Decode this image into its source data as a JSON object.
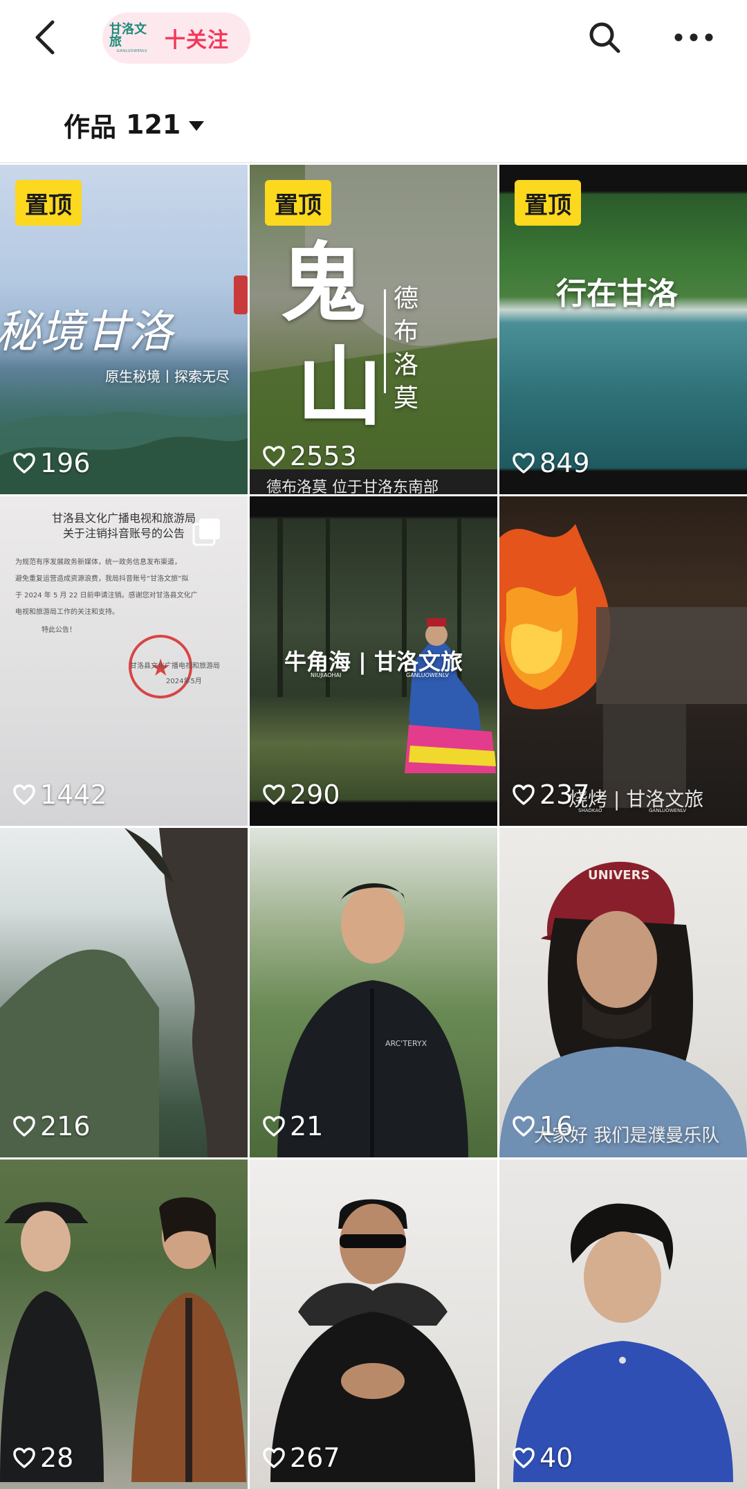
{
  "header": {
    "follow_button": "十关注",
    "brand_logo_text": "甘洛文旅",
    "brand_logo_subtext": "GANLUOWENLV"
  },
  "works": {
    "label": "作品",
    "count": "121"
  },
  "grid": {
    "pin_label": "置顶",
    "tiles": [
      {
        "likes": "196",
        "pinned": true,
        "title": "秘境甘洛",
        "subtitle": "原生秘境丨探索无尽"
      },
      {
        "likes": "2553",
        "pinned": true,
        "title_big_1": "鬼",
        "title_big_2": "山",
        "vertical_title": "德布洛莫",
        "caption": "德布洛莫 位于甘洛东南部"
      },
      {
        "likes": "849",
        "pinned": true,
        "title": "行在甘洛"
      },
      {
        "likes": "1442",
        "pinned": false,
        "doc_title_1": "甘洛县文化广播电视和旅游局",
        "doc_title_2": "关于注销抖音账号的公告",
        "doc_body_1": "为规范有序发展政务新媒体，统一政务信息发布渠道，",
        "doc_body_2": "避免重复运营造成资源浪费，我局抖音账号“甘洛文旅”拟",
        "doc_body_3": "于 2024 年 5 月 22 日前申请注销。感谢您对甘洛县文化广",
        "doc_body_4": "电视和旅游局工作的关注和支持。",
        "doc_body_5": "特此公告！",
        "doc_sign_1": "甘洛县文化广播电视和旅游局",
        "doc_sign_2": "2024年5月"
      },
      {
        "likes": "290",
        "pinned": false,
        "title": "牛角海 | 甘洛文旅",
        "title_pinyin_1": "NIUJIAOHAI",
        "title_pinyin_2": "GANLUOWENLV"
      },
      {
        "likes": "237",
        "pinned": false,
        "caption": "烧烤 | 甘洛文旅",
        "caption_pinyin_1": "SHAOKAO",
        "caption_pinyin_2": "GANLUOWENLV"
      },
      {
        "likes": "216",
        "pinned": false
      },
      {
        "likes": "21",
        "pinned": false,
        "shirt_text": "ARC'TERYX"
      },
      {
        "likes": "16",
        "pinned": false,
        "caption": "大家好 我们是濮曼乐队",
        "cap_text": "UNIVERS"
      },
      {
        "likes": "28",
        "pinned": false
      },
      {
        "likes": "267",
        "pinned": false
      },
      {
        "likes": "40",
        "pinned": false
      }
    ]
  },
  "colors": {
    "follow_pill_bg": "#fde8ee",
    "follow_text": "#f2385a",
    "pin_badge": "#fcd81e",
    "brand": "#1f8a7a"
  },
  "icons": {
    "back": "chevron-left-icon",
    "search": "search-icon",
    "more": "more-dots-icon",
    "caret": "caret-down-icon",
    "likes": "heart-outline-icon",
    "gallery": "gallery-icon"
  }
}
